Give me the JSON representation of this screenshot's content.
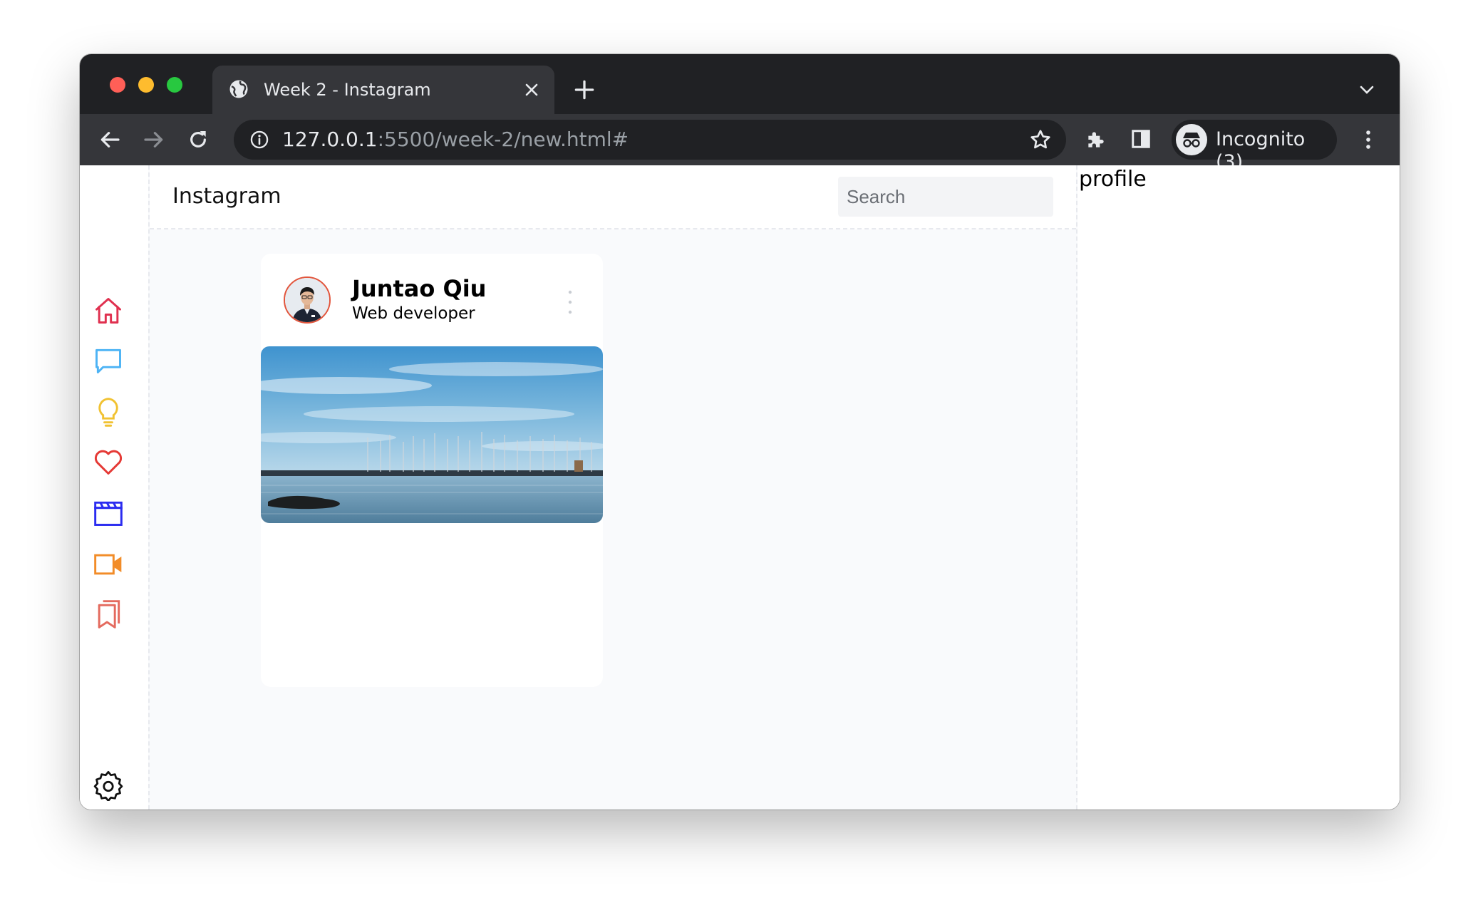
{
  "browser": {
    "tab_title": "Week 2 - Instagram",
    "url_host": "127.0.0.1",
    "url_rest": ":5500/week-2/new.html#",
    "profile_label": "Incognito (3)"
  },
  "app": {
    "brand": "Instagram",
    "search_placeholder": "Search"
  },
  "sidebar": {
    "items": [
      {
        "name": "home-icon",
        "color": "#e0304f"
      },
      {
        "name": "message-icon",
        "color": "#4cb3f5"
      },
      {
        "name": "lightbulb-icon",
        "color": "#f1c232"
      },
      {
        "name": "heart-icon",
        "color": "#e53935"
      },
      {
        "name": "clapperboard-icon",
        "color": "#2b2cf0"
      },
      {
        "name": "video-camera-icon",
        "color": "#f28c28"
      },
      {
        "name": "bookmarks-icon",
        "color": "#e46a5e"
      }
    ],
    "settings": {
      "name": "gear-icon",
      "color": "#111111"
    }
  },
  "post": {
    "author": "Juntao Qiu",
    "role": "Web developer"
  },
  "profile": {
    "title": "profile"
  }
}
